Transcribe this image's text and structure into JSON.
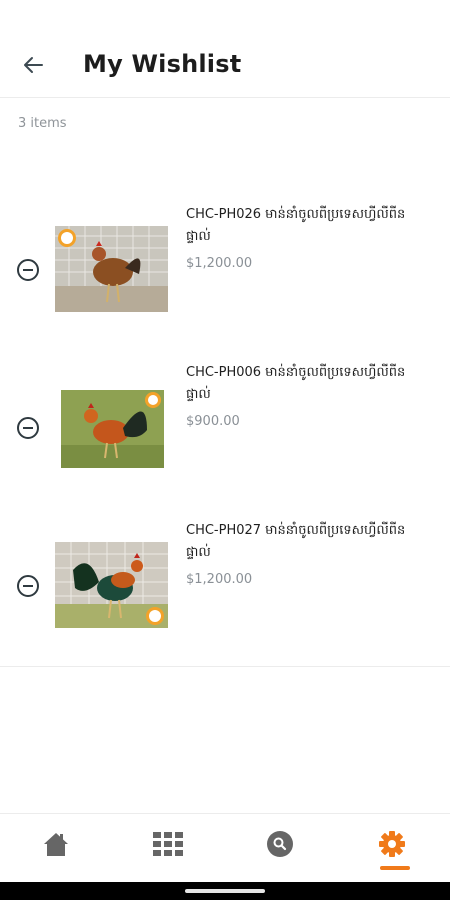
{
  "header": {
    "title": "My Wishlist",
    "back_icon": "arrow-left-icon"
  },
  "wishlist": {
    "count_label": "3 items",
    "items": [
      {
        "title": "CHC-PH026 មាន់នាំចូលពីប្រទេសហ្វីលីពីនផ្ទាល់",
        "price": "$1,200.00"
      },
      {
        "title": "CHC-PH006 មាន់នាំចូលពីប្រទេសហ្វីលីពីនផ្ទាល់",
        "price": "$900.00"
      },
      {
        "title": "CHC-PH027 មាន់នាំចូលពីប្រទេសហ្វីលីពីនផ្ទាល់",
        "price": "$1,200.00"
      }
    ]
  },
  "tabbar": {
    "tabs": [
      {
        "icon": "home-icon",
        "active": false
      },
      {
        "icon": "grid-icon",
        "active": false
      },
      {
        "icon": "search-icon",
        "active": false
      },
      {
        "icon": "gear-icon",
        "active": true
      }
    ]
  },
  "colors": {
    "accent": "#f07a1a",
    "icon_gray": "#666666",
    "price": "#8a9096"
  }
}
